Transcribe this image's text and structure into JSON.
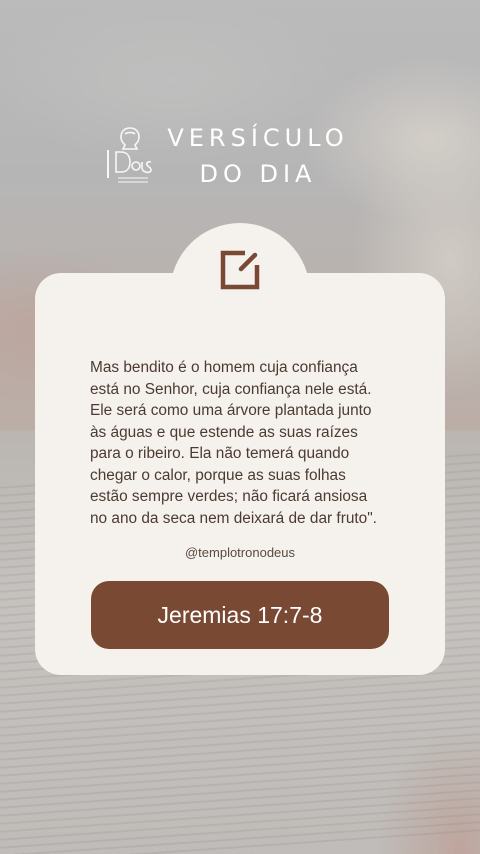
{
  "header": {
    "title_line1": "VERSÍCULO",
    "title_line2": "DO DIA"
  },
  "card": {
    "icon": "edit-icon",
    "verse_lines": [
      "Mas bendito é o homem cuja confiança",
      "está no Senhor, cuja confiança nele está.",
      "Ele será como uma árvore plantada junto",
      "às águas e que estende as suas raízes",
      "para o ribeiro. Ela não temerá quando",
      "chegar o calor, porque as suas folhas",
      "estão sempre verdes; não ficará ansiosa",
      "no ano da seca nem deixará de dar fruto\"."
    ],
    "handle": "@templotronodeus",
    "reference": "Jeremias 17:7-8"
  },
  "colors": {
    "card_bg": "#f5f1ec",
    "accent_brown": "#7a4934",
    "text_brown": "#4b3b32",
    "title_white": "#ffffff"
  }
}
